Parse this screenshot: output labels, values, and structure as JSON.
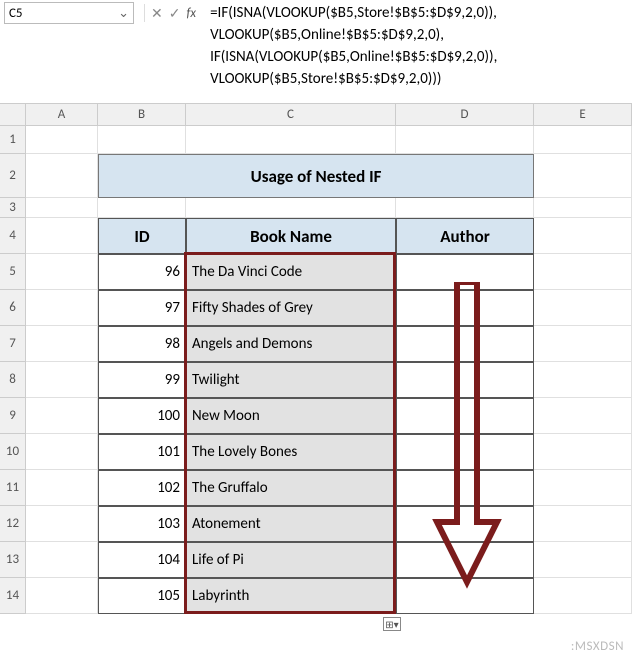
{
  "nameBox": {
    "value": "C5"
  },
  "formula": {
    "line1": "=IF(ISNA(VLOOKUP($B5,Store!$B$5:$D$9,2,0)),",
    "line2": "VLOOKUP($B5,Online!$B$5:$D$9,2,0),",
    "line3": "IF(ISNA(VLOOKUP($B5,Online!$B$5:$D$9,2,0)),",
    "line4": "VLOOKUP($B5,Store!$B$5:$D$9,2,0)))"
  },
  "columns": {
    "A": "A",
    "B": "B",
    "C": "C",
    "D": "D",
    "E": "E"
  },
  "rowNums": [
    "1",
    "2",
    "3",
    "4",
    "5",
    "6",
    "7",
    "8",
    "9",
    "10",
    "11",
    "12",
    "13",
    "14"
  ],
  "title": "Usage of Nested IF",
  "headers": {
    "id": "ID",
    "book": "Book Name",
    "author": "Author"
  },
  "data": [
    {
      "id": "96",
      "name": "The Da Vinci Code"
    },
    {
      "id": "97",
      "name": "Fifty Shades of Grey"
    },
    {
      "id": "98",
      "name": "Angels and Demons"
    },
    {
      "id": "99",
      "name": "Twilight"
    },
    {
      "id": "100",
      "name": "New Moon"
    },
    {
      "id": "101",
      "name": "The Lovely Bones"
    },
    {
      "id": "102",
      "name": "The Gruffalo"
    },
    {
      "id": "103",
      "name": "Atonement"
    },
    {
      "id": "104",
      "name": "Life of Pi"
    },
    {
      "id": "105",
      "name": "Labyrinth"
    }
  ],
  "icons": {
    "cancel": "✕",
    "confirm": "✓",
    "fx": "fx",
    "chev": "⌄",
    "expand": "⌄"
  },
  "watermark": ":MSXDSN"
}
